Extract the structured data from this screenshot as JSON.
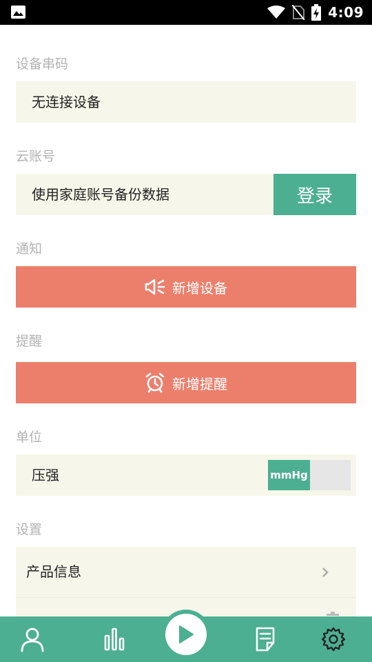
{
  "status_bar": {
    "time": "4:09",
    "icons": [
      "image-icon",
      "wifi-icon",
      "no-sim-icon",
      "battery-charging-icon"
    ]
  },
  "device_serial": {
    "label": "设备串码",
    "value": "无连接设备"
  },
  "cloud_account": {
    "label": "云账号",
    "description": "使用家庭账号备份数据",
    "login_label": "登录"
  },
  "notification": {
    "label": "通知",
    "button_label": "新增设备",
    "icon": "megaphone-icon"
  },
  "reminder": {
    "label": "提醒",
    "button_label": "新增提醒",
    "icon": "alarm-clock-icon"
  },
  "unit": {
    "label": "单位",
    "pressure_label": "压强",
    "selected_unit": "mmHg"
  },
  "settings": {
    "label": "设置",
    "items": [
      {
        "label": "产品信息",
        "icon": "chevron-right-icon"
      },
      {
        "label": "",
        "icon": "trash-icon"
      }
    ]
  },
  "bottom_nav": {
    "items": [
      "user-icon",
      "bar-chart-icon",
      "play-icon",
      "notes-icon",
      "gear-icon"
    ]
  },
  "colors": {
    "accent_green": "#4caf91",
    "accent_coral": "#ec7f6c",
    "card_bg": "#f6f6ea",
    "label_gray": "#b3b3b3"
  }
}
